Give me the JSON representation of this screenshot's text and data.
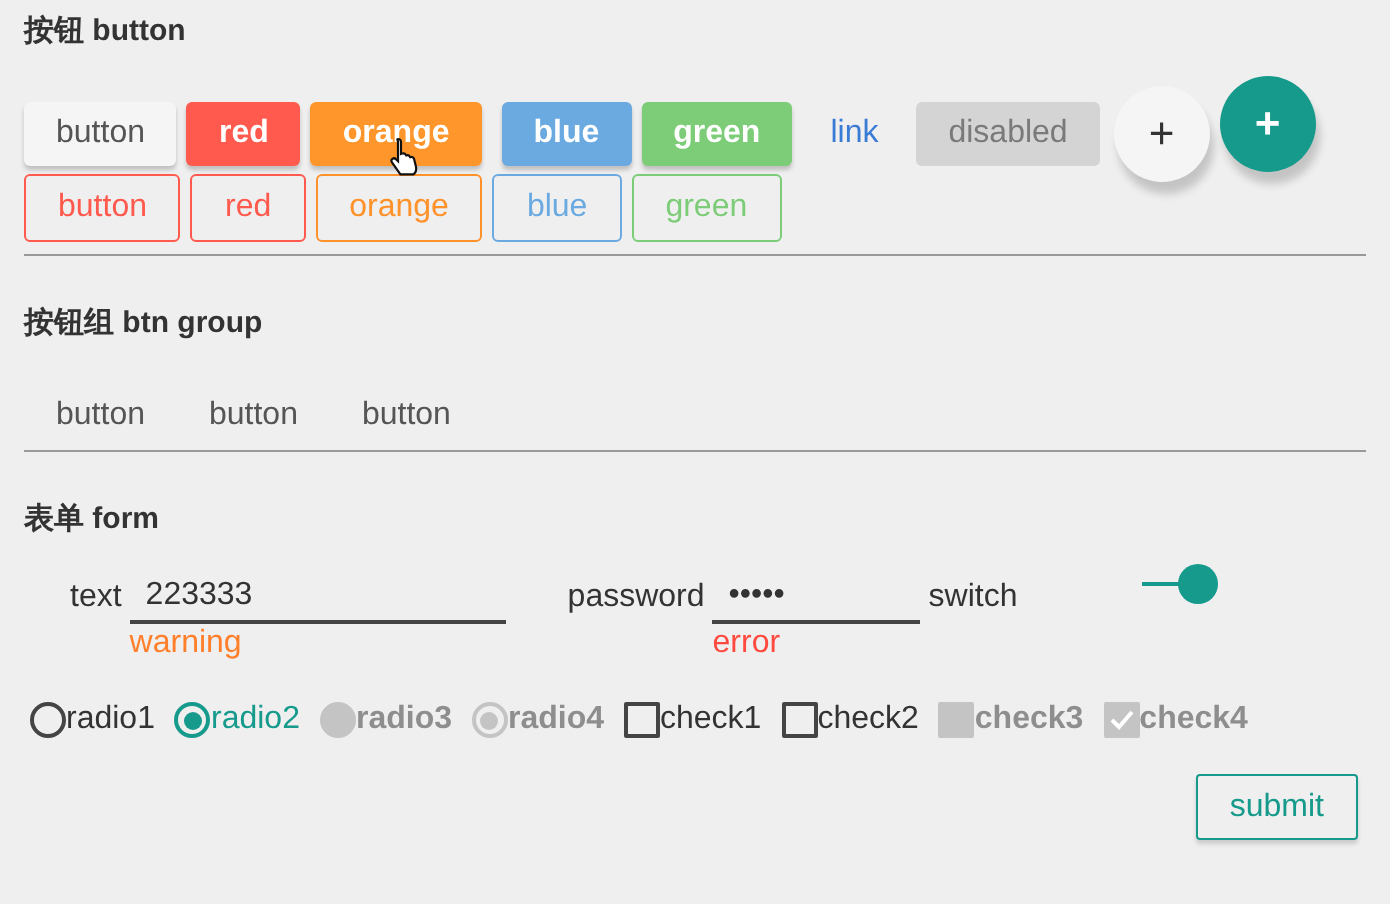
{
  "button_section": {
    "title": "按钮 button",
    "rows": [
      [
        {
          "label": "button",
          "kind": "solid",
          "color": "#f5f5f5",
          "disabled": false,
          "hovered": false
        },
        {
          "label": "red",
          "kind": "solid",
          "color": "#ff5a4d",
          "disabled": false,
          "hovered": false
        },
        {
          "label": "orange",
          "kind": "solid",
          "color": "#ff922b",
          "disabled": false,
          "hovered": true
        },
        {
          "label": "blue",
          "kind": "solid",
          "color": "#6aaae0",
          "disabled": false,
          "hovered": false
        },
        {
          "label": "green",
          "kind": "solid",
          "color": "#7ccc78",
          "disabled": false,
          "hovered": false
        },
        {
          "label": "link",
          "kind": "flat",
          "color": "#3a7bd5",
          "disabled": false,
          "hovered": false
        },
        {
          "label": "disabled",
          "kind": "solid",
          "color": "#d4d4d4",
          "disabled": true,
          "hovered": false
        },
        {
          "label": "+",
          "kind": "round",
          "color": "#f5f5f5",
          "disabled": false,
          "hovered": false
        },
        {
          "label": "+",
          "kind": "round",
          "color": "#159a8c",
          "disabled": false,
          "hovered": false
        }
      ],
      [
        {
          "label": "button",
          "kind": "outline",
          "color": "#ff5a4d",
          "disabled": false,
          "hovered": false
        },
        {
          "label": "red",
          "kind": "outline",
          "color": "#ff5a4d",
          "disabled": false,
          "hovered": false
        },
        {
          "label": "orange",
          "kind": "outline",
          "color": "#ff922b",
          "disabled": false,
          "hovered": false
        },
        {
          "label": "blue",
          "kind": "outline",
          "color": "#6aaae0",
          "disabled": false,
          "hovered": false
        },
        {
          "label": "green",
          "kind": "outline",
          "color": "#7ccc78",
          "disabled": false,
          "hovered": false
        }
      ]
    ]
  },
  "group_section": {
    "title": "按钮组 btn group",
    "buttons": [
      "button",
      "button",
      "button"
    ]
  },
  "form_section": {
    "title": "表单 form",
    "fields": [
      {
        "label": "text",
        "value": "223333",
        "hint": "warning",
        "color": "#ff7f2a"
      },
      {
        "label": "password",
        "value": "•••••",
        "hint": "error",
        "color": "#ff4a40"
      }
    ],
    "switch": {
      "label": "switch",
      "on": true
    },
    "options": [
      {
        "kind": "radio",
        "label": "radio1",
        "selected": false,
        "disabled": false
      },
      {
        "kind": "radio",
        "label": "radio2",
        "selected": true,
        "disabled": false
      },
      {
        "kind": "radio",
        "label": "radio3",
        "selected": false,
        "disabled": true
      },
      {
        "kind": "radio",
        "label": "radio4",
        "selected": true,
        "disabled": true
      },
      {
        "kind": "checkbox",
        "label": "check1",
        "checked": false,
        "disabled": false
      },
      {
        "kind": "checkbox",
        "label": "check2",
        "checked": false,
        "disabled": false
      },
      {
        "kind": "checkbox",
        "label": "check3",
        "checked": false,
        "disabled": true
      },
      {
        "kind": "checkbox",
        "label": "check4",
        "checked": true,
        "disabled": true
      }
    ],
    "submit": "submit"
  }
}
